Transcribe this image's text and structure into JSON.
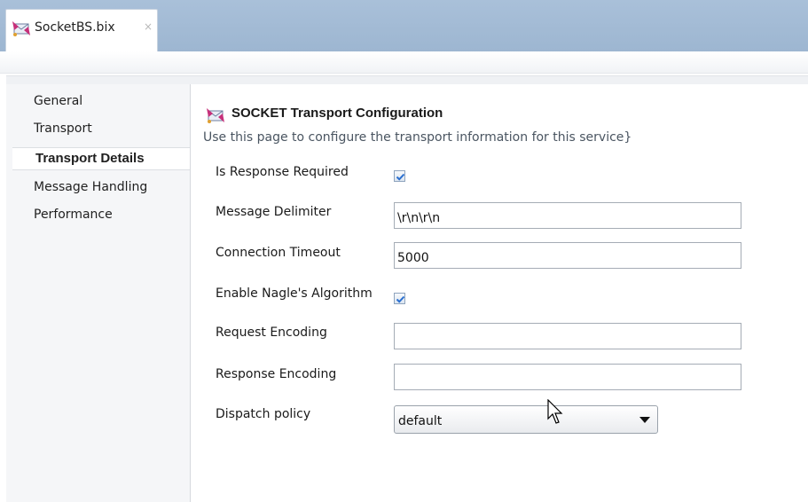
{
  "tab": {
    "label": "SocketBS.bix",
    "close": "×"
  },
  "nav": {
    "items": [
      {
        "label": "General"
      },
      {
        "label": "Transport"
      },
      {
        "label": "Transport Details"
      },
      {
        "label": "Message Handling"
      },
      {
        "label": "Performance"
      }
    ],
    "selected": "Transport Details"
  },
  "section": {
    "title": "SOCKET Transport Configuration",
    "description": "Use this page to configure the transport information for this service}"
  },
  "fields": {
    "is_response_required": {
      "label": "Is Response Required",
      "checked": true
    },
    "message_delimiter": {
      "label": "Message Delimiter",
      "value": "\\r\\n\\r\\n"
    },
    "connection_timeout": {
      "label": "Connection Timeout",
      "value": "5000"
    },
    "enable_nagle": {
      "label": "Enable Nagle's Algorithm",
      "checked": true
    },
    "request_encoding": {
      "label": "Request Encoding",
      "value": ""
    },
    "response_encoding": {
      "label": "Response Encoding",
      "value": ""
    },
    "dispatch_policy": {
      "label": "Dispatch policy",
      "value": "default"
    }
  },
  "colors": {
    "tabbar": "#a9c0d9",
    "nav_background": "#f5f6f8",
    "check_mark": "#2a6fd0"
  }
}
